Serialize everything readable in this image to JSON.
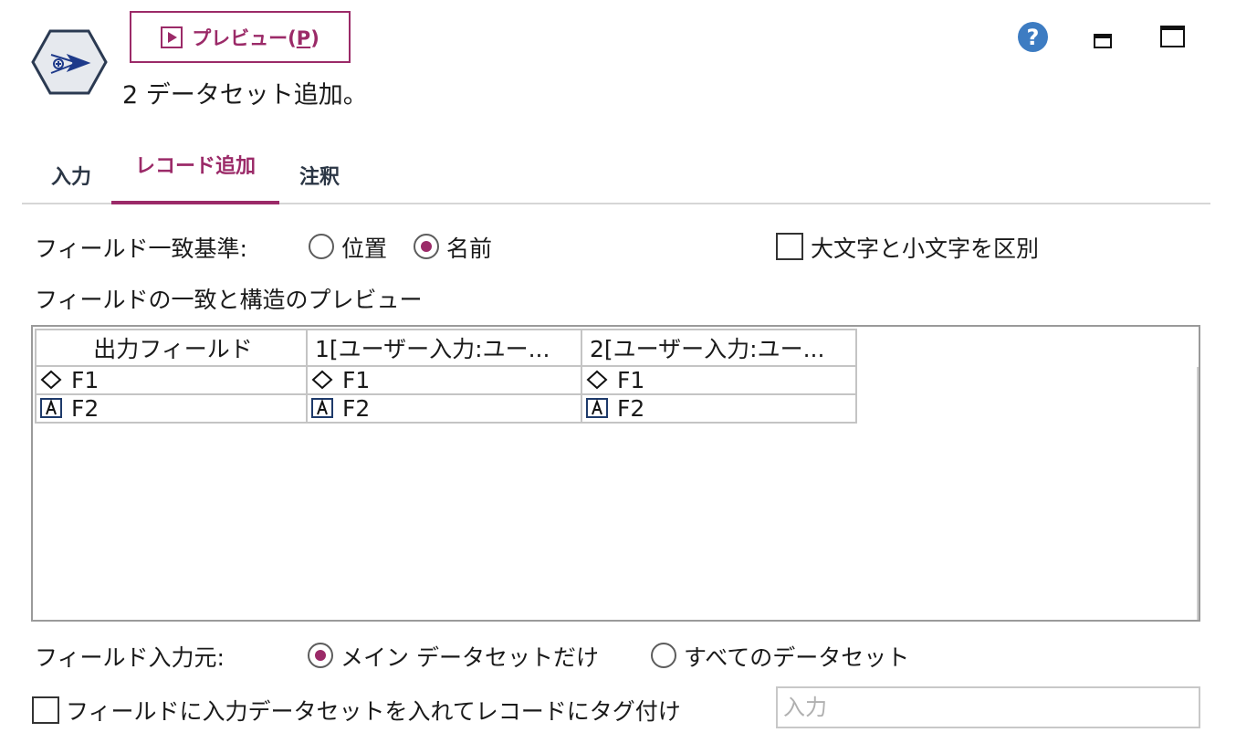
{
  "header": {
    "preview_button": {
      "label": "プレビュー(",
      "mnemonic": "P",
      "suffix": ")"
    },
    "subtitle": "2 データセット追加。",
    "help_glyph": "?"
  },
  "icons": {
    "node": "append-node-icon",
    "help": "help-icon",
    "minimize": "minimize-icon",
    "maximize": "maximize-icon",
    "preview": "play-icon"
  },
  "tabs": [
    {
      "label": "入力",
      "active": false
    },
    {
      "label": "レコード追加",
      "active": true
    },
    {
      "label": "注釈",
      "active": false
    }
  ],
  "match": {
    "label": "フィールド一致基準:",
    "options": [
      {
        "label": "位置",
        "selected": false
      },
      {
        "label": "名前",
        "selected": true
      }
    ],
    "case_sensitive": {
      "label": "大文字と小文字を区別",
      "checked": false
    }
  },
  "preview_section": {
    "label": "フィールドの一致と構造のプレビュー",
    "columns": [
      "出力フィールド",
      "1[ユーザー入力:ユー...",
      "2[ユーザー入力:ユー..."
    ],
    "rows": [
      {
        "type_icon": "continuous-diamond-icon",
        "cells": [
          "F1",
          "F1",
          "F1"
        ]
      },
      {
        "type_icon": "nominal-a-icon",
        "cells": [
          "F2",
          "F2",
          "F2"
        ]
      }
    ]
  },
  "field_source": {
    "label": "フィールド入力元:",
    "options": [
      {
        "label": "メイン データセットだけ",
        "selected": true
      },
      {
        "label": "すべてのデータセット",
        "selected": false
      }
    ]
  },
  "tagging": {
    "checkbox_label": "フィールドに入力データセットを入れてレコードにタグ付け",
    "checked": false,
    "input_placeholder": "入力",
    "input_value": ""
  },
  "colors": {
    "accent": "#9b2a68",
    "help_blue": "#3d7cc2",
    "tab_text": "#2b3645"
  }
}
